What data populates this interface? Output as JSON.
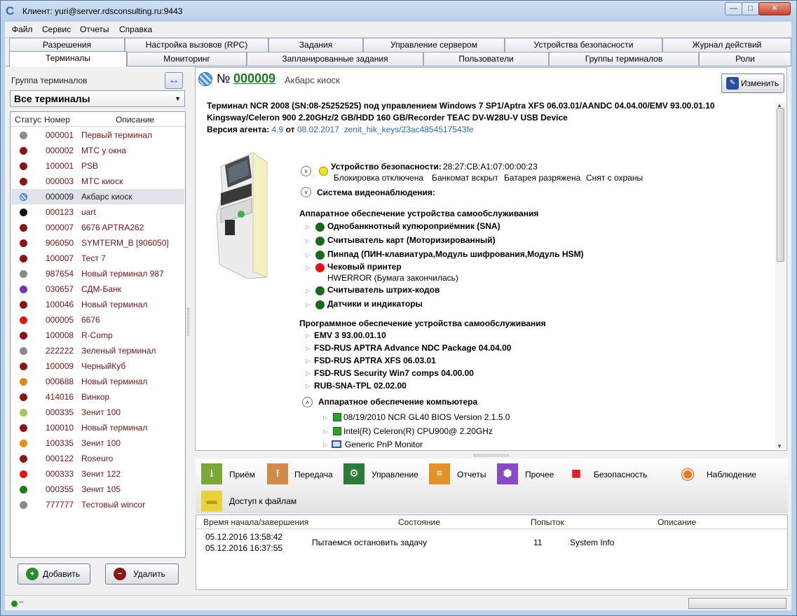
{
  "window": {
    "title": "Клиент: yuri@server.rdsconsulting.ru:9443"
  },
  "menu": [
    "Файл",
    "Сервис",
    "Отчеты",
    "Справка"
  ],
  "tabs_row1": [
    "Разрешения",
    "Настройка вызовов (RPC)",
    "Задания",
    "Управление сервером",
    "Устройства безопасности",
    "Журнал действий"
  ],
  "tabs_row2": [
    "Терминалы",
    "Мониторинг",
    "Запланированные задания",
    "Пользователи",
    "Группы терминалов",
    "Роли"
  ],
  "left": {
    "group_label": "Группа терминалов",
    "group_value": "Все терминалы",
    "headers": {
      "status": "Статус",
      "number": "Номер",
      "description": "Описание"
    },
    "terminals": [
      {
        "num": "000001",
        "desc": "Первый терминал",
        "color": "#8a8a8a"
      },
      {
        "num": "000002",
        "desc": "МТС у окна",
        "color": "#8b1414"
      },
      {
        "num": "100001",
        "desc": "PSB",
        "color": "#8b1414"
      },
      {
        "num": "000003",
        "desc": "МТС киоск",
        "color": "#8b1414"
      },
      {
        "num": "000009",
        "desc": "Акбарс киоск",
        "color": "#4a8fe0",
        "selected": true
      },
      {
        "num": "000123",
        "desc": "uart",
        "color": "#111111"
      },
      {
        "num": "000007",
        "desc": "6676 APTRA262",
        "color": "#8b1414"
      },
      {
        "num": "906050",
        "desc": "SYMTERM_B [906050]",
        "color": "#8b1414"
      },
      {
        "num": "100007",
        "desc": "Тест 7",
        "color": "#8b1414"
      },
      {
        "num": "987654",
        "desc": "Новый терминал 987",
        "color": "#8a8a8a"
      },
      {
        "num": "030657",
        "desc": "СДМ-Банк",
        "color": "#7b2fb8"
      },
      {
        "num": "100046",
        "desc": "Новый терминал",
        "color": "#8b1414"
      },
      {
        "num": "000005",
        "desc": "6676",
        "color": "#e31414"
      },
      {
        "num": "100008",
        "desc": "R-Comp",
        "color": "#8b1414"
      },
      {
        "num": "222222",
        "desc": "Зеленый терминал",
        "color": "#8a8a8a"
      },
      {
        "num": "100009",
        "desc": "ЧерныйКуб",
        "color": "#8b1414"
      },
      {
        "num": "000688",
        "desc": "Новый терминал",
        "color": "#e08a1e"
      },
      {
        "num": "414016",
        "desc": "Винкор",
        "color": "#8b1414"
      },
      {
        "num": "000335",
        "desc": "Зенит 100",
        "color": "#a9c460"
      },
      {
        "num": "100010",
        "desc": "Новый терминал",
        "color": "#8b1414"
      },
      {
        "num": "100335",
        "desc": "Зенит 100",
        "color": "#f08a10"
      },
      {
        "num": "000122",
        "desc": "Roseuro",
        "color": "#8b1414"
      },
      {
        "num": "000333",
        "desc": "Зенит 122",
        "color": "#e31414"
      },
      {
        "num": "000355",
        "desc": "Зенит 105",
        "color": "#1a7a1a"
      },
      {
        "num": "777777",
        "desc": "Тестовый wincor",
        "color": "#8a8a8a"
      }
    ],
    "add_label": "Добавить",
    "delete_label": "Удалить"
  },
  "detail": {
    "no_label": "№",
    "number": "000009",
    "name": "Акбарс киоск",
    "edit_label": "Изменить",
    "line1": "Терминал NCR 2008 (SN:08-25252525) под управлением Windows 7 SP1/Aptra XFS 06.03.01/AANDC 04.04.00/EMV 93.00.01.10",
    "line2": "Kingsway/Celeron 900 2.20GHz/2 GB/HDD 160 GB/Recorder TEAC DV-W28U-V USB Device",
    "agent_label": "Версия агента:",
    "agent_version": "4.9",
    "agent_from": "от",
    "agent_date": "08.02.2017",
    "agent_keys": "zenit_hik_keys/23ac4854517543fe",
    "security_label": "Устройство безопасности:",
    "security_mac": "28:27:CB:A1:07:00:00:23",
    "security_flags": [
      "Блокировка отключена",
      "Банкомат вскрыт",
      "Батарея разряжена",
      "Снят с охраны"
    ],
    "video_label": "Система видеонаблюдения:",
    "hw_title": "Аппаратное обеспечение устройства самообслуживания",
    "hw_items": [
      {
        "label": "Однобанкнотный купюроприёмник (SNA)",
        "color": "#1a6a1a"
      },
      {
        "label": "Считыватель карт (Моторизированный)",
        "color": "#1a6a1a"
      },
      {
        "label": "Пинпад (ПИН-клавиатура,Модуль шифрования,Модуль HSM)",
        "color": "#1a6a1a"
      },
      {
        "label": "Чековый принтер",
        "color": "#e31414",
        "sub": "HWERROR (Бумага закончилась)"
      },
      {
        "label": "Считыватель штрих-кодов",
        "color": "#1a6a1a"
      },
      {
        "label": "Датчики и индикаторы",
        "color": "#1a6a1a"
      }
    ],
    "sw_title": "Программное обеспечение устройства самообслуживания",
    "sw_items": [
      "EMV 3 93.00.01.10",
      "FSD-RUS APTRA Advance NDC Package 04.04.00",
      "FSD-RUS APTRA XFS 06.03.01",
      "FSD-RUS Security  Win7 comps 04.00.00",
      "RUB-SNA-TPL 02.02.00"
    ],
    "pc_title": "Аппаратное обеспечение компьютера",
    "pc_items": [
      "08/19/2010 NCR GL40 BIOS Version 2.1.5.0",
      "Intel(R) Celeron(R) CPU900@ 2.20GHz",
      "Generic PnP Monitor"
    ]
  },
  "toolbar": [
    {
      "label": "Приём",
      "icon": "download-icon",
      "color": "#7aa63a"
    },
    {
      "label": "Передача",
      "icon": "upload-icon",
      "color": "#d28a4a"
    },
    {
      "label": "Управление",
      "icon": "server-gear-icon",
      "color": "#2e7a3a"
    },
    {
      "label": "Отчеты",
      "icon": "report-icon",
      "color": "#e6902a"
    },
    {
      "label": "Прочее",
      "icon": "hexagons-icon",
      "color": "#8a4ac8"
    },
    {
      "label": "Безопасность",
      "icon": "lock-icon",
      "color": "#e0202a"
    },
    {
      "label": "Наблюдение",
      "icon": "eye-icon",
      "color": "#e8781a"
    },
    {
      "label": "Доступ к файлам",
      "icon": "folder-icon",
      "color": "#e8d23a"
    }
  ],
  "tasks": {
    "headers": [
      "Время начала/завершения",
      "Состояние",
      "Попыток",
      "Описание"
    ],
    "rows": [
      {
        "start": "05.12.2016 13:58:42",
        "end": "05.12.2016 16:37:55",
        "state": "Пытаемся остановить задачу",
        "attempts": "11",
        "desc": "System Info"
      }
    ]
  },
  "status": {
    "text": "--"
  }
}
